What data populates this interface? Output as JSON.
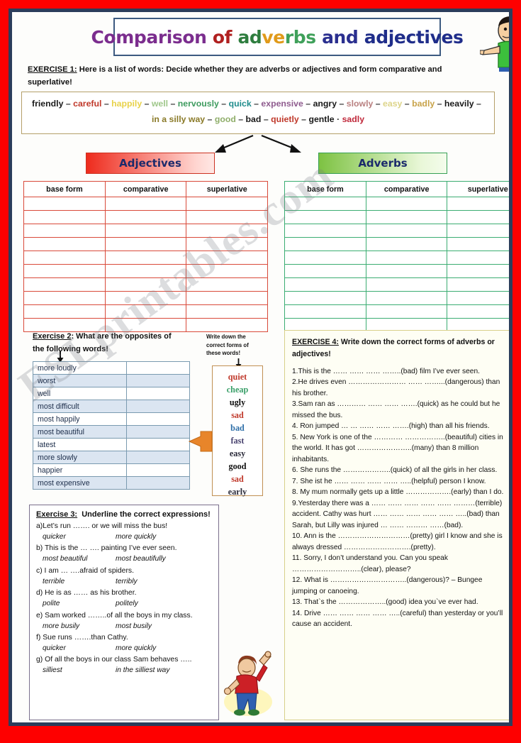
{
  "page": {
    "outer_border_color": "#fe0000",
    "inner_border_color": "#2b3d5b",
    "paper_color": "#fdfdfb",
    "watermark": "ESLprintables.com"
  },
  "title": {
    "parts": [
      {
        "text": "Comparison",
        "color": "#7b2d8e"
      },
      {
        "text": " of ",
        "color": "#b02020"
      },
      {
        "text": "ad",
        "color": "#e09a1a"
      },
      {
        "text": "ve",
        "color": "#c8c23a"
      },
      {
        "text": "rbs",
        "color": "#3fa05a"
      },
      {
        "text": " and ",
        "color": "#2a2f8f"
      },
      {
        "text": "adjectives",
        "color": "#1f2d8a"
      }
    ],
    "plain": "Comparison of adverbs and adjectives"
  },
  "exercise1": {
    "label": "EXERCISE 1:",
    "instruction": "Here is a list of words: Decide whether they are adverbs or adjectives  and form comparative and superlative!",
    "words_line1": [
      {
        "text": "friendly",
        "color": "#1a1a1a"
      },
      {
        "text": "careful",
        "color": "#c0392b"
      },
      {
        "text": "happily",
        "color": "#e8d24a"
      },
      {
        "text": "well",
        "color": "#9fc78a"
      },
      {
        "text": "nervously",
        "color": "#3e9b5f"
      },
      {
        "text": "quick",
        "color": "#1f8c8c"
      },
      {
        "text": "expensive",
        "color": "#8e5b8e"
      },
      {
        "text": "angry",
        "color": "#1a1a1a"
      },
      {
        "text": "slowly",
        "color": "#b98080"
      },
      {
        "text": "easy",
        "color": "#ddd489"
      },
      {
        "text": "badly",
        "color": "#c8a34a"
      },
      {
        "text": "heavily",
        "color": "#1a1a1a"
      }
    ],
    "words_line2": [
      {
        "text": "in a silly way",
        "color": "#8a7a28"
      },
      {
        "text": "good",
        "color": "#8fae6a"
      },
      {
        "text": "bad",
        "color": "#1a1a1a"
      },
      {
        "text": "quietly",
        "color": "#c0392b"
      },
      {
        "text": "gentle",
        "color": "#1a1a1a"
      },
      {
        "text": "sadly",
        "color": "#c0293b"
      }
    ],
    "separator": "–",
    "separator_last": "·"
  },
  "categories": {
    "adjectives_label": "Adjectives",
    "adverbs_label": "Adverbs",
    "adjectives_accent": "#ee2b1d",
    "adverbs_accent": "#7dc242"
  },
  "form_tables": {
    "columns": [
      "base form",
      "comparative",
      "superlative"
    ],
    "adjectives_empty_rows": 10,
    "adverbs_empty_rows": 10,
    "adjectives_border": "#d94a3a",
    "adverbs_border": "#3bad72"
  },
  "exercise2": {
    "label": "Exercise 2",
    "instruction": ": What are the opposites of the following words!",
    "rows": [
      {
        "word": "more loudly",
        "answer": ""
      },
      {
        "word": "worst",
        "answer": ""
      },
      {
        "word": "well",
        "answer": ""
      },
      {
        "word": "most difficult",
        "answer": ""
      },
      {
        "word": "most happily",
        "answer": ""
      },
      {
        "word": "most beautiful",
        "answer": ""
      },
      {
        "word": "latest",
        "answer": ""
      },
      {
        "word": "more slowly",
        "answer": ""
      },
      {
        "word": "happier",
        "answer": ""
      },
      {
        "word": "most expensive",
        "answer": ""
      }
    ],
    "shade_color": "#dbe5f1"
  },
  "word_box": {
    "instruction": "Write down the correct forms of these words!",
    "words": [
      {
        "text": "quiet",
        "color": "#c0392b"
      },
      {
        "text": "cheap",
        "color": "#3ba06a"
      },
      {
        "text": "ugly",
        "color": "#111111"
      },
      {
        "text": "sad",
        "color": "#c0392b"
      },
      {
        "text": "bad",
        "color": "#2e6fa8"
      },
      {
        "text": "fast",
        "color": "#4a4470"
      },
      {
        "text": "easy",
        "color": "#2b2b3a"
      },
      {
        "text": "good",
        "color": "#111111"
      },
      {
        "text": "sad",
        "color": "#c0392b"
      },
      {
        "text": "early",
        "color": "#2b2b3a"
      }
    ]
  },
  "exercise3": {
    "label": "Exercise 3:",
    "instruction": "Underline the correct expressions!",
    "items": [
      {
        "question": "a)Let’s run ……. or we will miss the bus!",
        "option1": "quicker",
        "option2": "more quickly"
      },
      {
        "question": "b) This is the … …. painting I’ve ever seen.",
        "option1": "most beautiful",
        "option2": "most beautifully"
      },
      {
        "question": "c) I am … ….afraid of spiders.",
        "option1": "terrible",
        "option2": "terribly"
      },
      {
        "question": "d) He is as ……  as  his brother.",
        "option1": "polite",
        "option2": "politely"
      },
      {
        "question": " e) Sam worked ……..of all the boys in my class.",
        "option1": "more busily",
        "option2": "most busily"
      },
      {
        "question": "f) Sue runs …….than Cathy.",
        "option1": "quicker",
        "option2": "more quickly"
      },
      {
        "question": "g) Of all the boys in our class Sam behaves …..",
        "option1": "silliest",
        "option2": "in the silliest way"
      }
    ]
  },
  "exercise4": {
    "label": "EXERCISE 4:",
    "instruction": "Write down the correct forms of adverbs or adjectives!",
    "items": [
      "1.This is the …… …… …… ……..(bad) film I’ve ever seen.",
      "2.He drives even …………………… …… ……...(dangerous) than his brother.",
      "3.Sam ran as ………… …… …… …….(quick) as he could but he missed the bus.",
      "4. Ron jumped … … …… …… …….(high) than all his friends.",
      "5. New York is one of the ………… ……………..(beautiful) cities in the world. It has got  …………………..(many) than 8 million inhabitants.",
      "6. She runs the ………………..(quick) of all the girls in her class.",
      "7. She ist he …… …… …… …… …..(helpful) person I know.",
      "8. My mum normally gets up a little ……………….(early) than I do.",
      "9.Yesterday there was a …… …… …… …… …… ………(terrible) accident. Cathy was hurt …… …… …… …… …… …..(bad) than Sarah, but Lilly was injured … …… ……… ……(bad).",
      "10. Ann is the …………………………(pretty) girl I know and she is always dressed ……………………….(pretty).",
      "11. Sorry, I don’t understand you. Can you speak ………………………..(clear), please?",
      "12. What is …………………………..(dangerous)? – Bungee jumping or canoeing.",
      "13. That`s the ………………..(good) idea you`ve ever had.",
      "14. Drive …… …… …… …… …..(careful) than yesterday or you’ll cause an accident."
    ]
  },
  "illustrations": {
    "top_right": "boy-pointing-left-green-shirt",
    "bottom_center": "boy-pointing-up-red-shirt",
    "orange_arrow": "left-pointing-orange-arrow"
  }
}
